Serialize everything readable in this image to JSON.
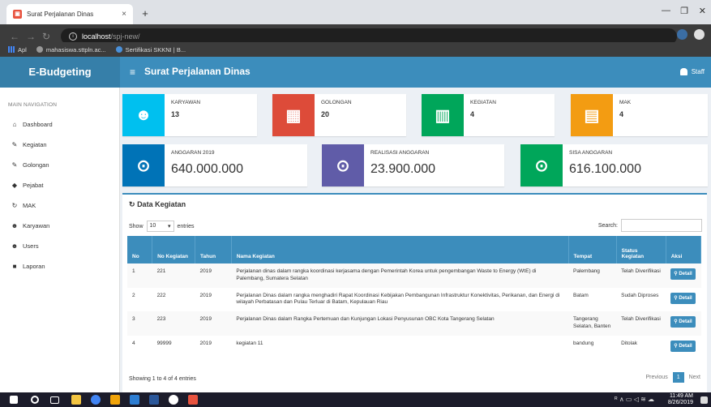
{
  "browser": {
    "tab_title": "Surat Perjalanan Dinas",
    "url_host": "localhost",
    "url_path": "/spj-new/",
    "bookmarks": [
      "Apl",
      "mahasiswa.sttpln.ac...",
      "Sertifikasi SKKNI | B..."
    ]
  },
  "app": {
    "brand": "E-Budgeting",
    "page_title": "Surat Perjalanan Dinas",
    "user": "Staff"
  },
  "sidebar": {
    "heading": "MAIN NAVIGATION",
    "items": [
      {
        "label": "Dashboard",
        "icon": "home-icon"
      },
      {
        "label": "Kegiatan",
        "icon": "edit-icon"
      },
      {
        "label": "Golongan",
        "icon": "edit-icon"
      },
      {
        "label": "Pejabat",
        "icon": "shield-icon"
      },
      {
        "label": "MAK",
        "icon": "refresh-icon"
      },
      {
        "label": "Karyawan",
        "icon": "users-icon"
      },
      {
        "label": "Users",
        "icon": "users-icon"
      },
      {
        "label": "Laporan",
        "icon": "folder-icon"
      }
    ]
  },
  "stats": {
    "karyawan": {
      "label": "KARYAWAN",
      "value": "13",
      "color": "#00c0ef"
    },
    "golongan": {
      "label": "GOLONGAN",
      "value": "20",
      "color": "#dd4b39"
    },
    "kegiatan": {
      "label": "KEGIATAN",
      "value": "4",
      "color": "#00a65a"
    },
    "mak": {
      "label": "MAK",
      "value": "4",
      "color": "#f39c12"
    },
    "anggaran": {
      "label": "ANGGARAN 2019",
      "value": "640.000.000",
      "color": "#0073b7"
    },
    "realisasi": {
      "label": "REALISASI ANGGARAN",
      "value": "23.900.000",
      "color": "#605ca8"
    },
    "sisa": {
      "label": "SISA ANGGARAN",
      "value": "616.100.000",
      "color": "#00a65a"
    }
  },
  "table": {
    "title": "Data Kegiatan",
    "show_label": "Show",
    "show_value": "10",
    "entries_label": "entries",
    "search_label": "Search:",
    "headers": {
      "no": "No",
      "no_kegiatan": "No Kegiatan",
      "tahun": "Tahun",
      "nama": "Nama Kegiatan",
      "tempat": "Tempat",
      "status": "Status Kegiatan",
      "aksi": "Aksi"
    },
    "rows": [
      {
        "no": "1",
        "no_kegiatan": "221",
        "tahun": "2019",
        "nama": "Perjalanan dinas dalam rangka koordinasi kerjasama dengan Pemerintah Korea untuk pengembangan Waste to Energy (WtE) di Palembang, Sumatera Selatan",
        "tempat": "Palembang",
        "status": "Telah Diverifikasi",
        "aksi": "Detail"
      },
      {
        "no": "2",
        "no_kegiatan": "222",
        "tahun": "2019",
        "nama": "Perjalanan Dinas dalam rangka menghadiri Rapat Koordinasi Kebijakan Pembangunan Infrastruktur Konektivitas, Perikanan, dan Energi di wilayah Perbatasan dan Pulau Terluar di Batam, Kepulauan Riau",
        "tempat": "Batam",
        "status": "Sudah Diproses",
        "aksi": "Detail"
      },
      {
        "no": "3",
        "no_kegiatan": "223",
        "tahun": "2019",
        "nama": "Perjalanan Dinas dalam Rangka Pertemuan dan Kunjungan Lokasi Penyusunan OBC Kota Tangerang Selatan",
        "tempat": "Tangerang Selatan, Banten",
        "status": "Telah Diverifikasi",
        "aksi": "Detail"
      },
      {
        "no": "4",
        "no_kegiatan": "99999",
        "tahun": "2019",
        "nama": "kegiatan 11",
        "tempat": "bandung",
        "status": "Ditolak",
        "aksi": "Detail"
      }
    ],
    "info": "Showing 1 to 4 of 4 entries",
    "prev": "Previous",
    "page": "1",
    "next": "Next"
  },
  "taskbar": {
    "time": "11:49 AM",
    "date": "8/26/2019"
  }
}
